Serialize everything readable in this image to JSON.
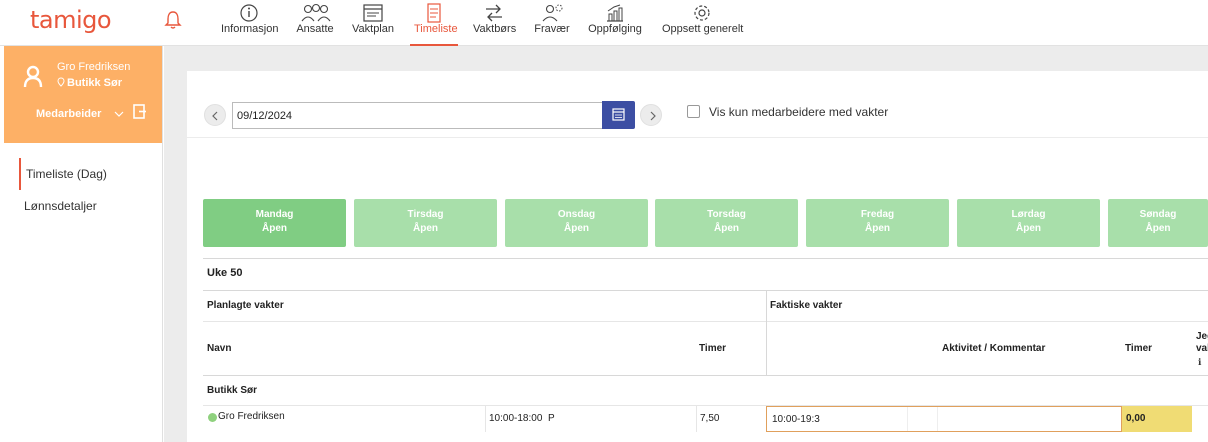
{
  "header": {
    "logo": "tamigo",
    "nav": [
      {
        "label": "Informasjon",
        "icon": "info-icon"
      },
      {
        "label": "Ansatte",
        "icon": "people-icon"
      },
      {
        "label": "Vaktplan",
        "icon": "schedule-icon"
      },
      {
        "label": "Timeliste",
        "icon": "timesheet-icon",
        "active": true
      },
      {
        "label": "Vaktbørs",
        "icon": "swap-arrows-icon"
      },
      {
        "label": "Fravær",
        "icon": "absence-icon"
      },
      {
        "label": "Oppfølging",
        "icon": "chart-icon"
      },
      {
        "label": "Oppsett generelt",
        "icon": "gear-icon"
      }
    ]
  },
  "sidebar": {
    "user_name": "Gro Fredriksen",
    "store": "Butikk Sør",
    "employees_label": "Medarbeider",
    "items": [
      {
        "label": "Timeliste (Dag)",
        "active": true
      },
      {
        "label": "Lønnsdetaljer"
      }
    ]
  },
  "toolbar": {
    "date_value": "09/12/2024",
    "only_with_shifts_label": "Vis kun medarbeidere med vakter"
  },
  "days": [
    {
      "name": "Mandag",
      "status": "Åpen",
      "active": true
    },
    {
      "name": "Tirsdag",
      "status": "Åpen"
    },
    {
      "name": "Onsdag",
      "status": "Åpen"
    },
    {
      "name": "Torsdag",
      "status": "Åpen"
    },
    {
      "name": "Fredag",
      "status": "Åpen"
    },
    {
      "name": "Lørdag",
      "status": "Åpen"
    },
    {
      "name": "Søndag",
      "status": "Åpen"
    }
  ],
  "table": {
    "week": "Uke 50",
    "planned_header": "Planlagte vakter",
    "actual_header": "Faktiske vakter",
    "col_name": "Navn",
    "col_hours": "Timer",
    "col_activity": "Aktivitet / Kommentar",
    "col_actual_hours": "Timer",
    "col_extra_line1": "Jeg",
    "col_extra_line2": "vak",
    "col_extra_info": "ℹ",
    "group": "Butikk Sør",
    "rows": [
      {
        "name": "Gro Fredriksen",
        "planned_time": "10:00-18:00",
        "planned_code": "P",
        "planned_hours": "7,50",
        "actual_time": "10:00-19:3",
        "actual_hours": "0,00"
      }
    ]
  },
  "colors": {
    "brand": "#e8573c",
    "profile_bg": "#fdb066",
    "calendar_button": "#3c4ea3",
    "day_active": "#80cd83",
    "day_inactive": "#a8dfaa",
    "hours_highlight": "#f0dc74"
  }
}
